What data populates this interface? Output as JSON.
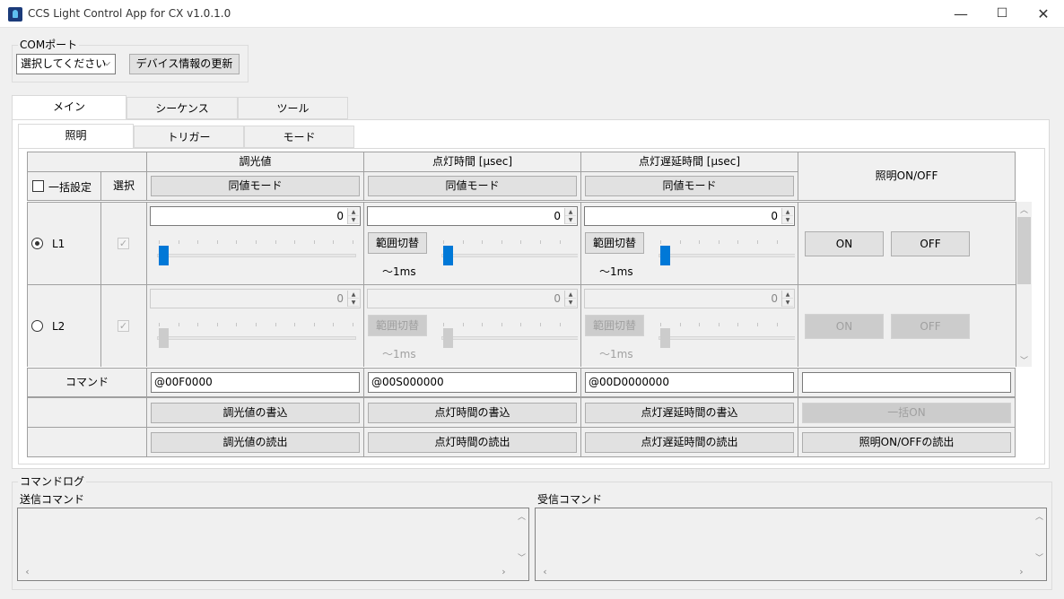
{
  "window": {
    "title": "CCS Light Control App for CX v1.0.1.0",
    "minimize": "—",
    "maximize": "☐",
    "close": "✕"
  },
  "com": {
    "group_label": "COMポート",
    "select_value": "選択してください",
    "refresh_button": "デバイス情報の更新"
  },
  "tabs": [
    "メイン",
    "シーケンス",
    "ツール"
  ],
  "subtabs": [
    "照明",
    "トリガー",
    "モード"
  ],
  "header": {
    "batch_label": "一括設定",
    "select_label": "選択",
    "col_dimming": "調光値",
    "col_on_time": "点灯時間 [μsec]",
    "col_delay": "点灯遅延時間 [μsec]",
    "col_onoff": "照明ON/OFF",
    "same_mode": "同値モード"
  },
  "channels": [
    {
      "name": "L1",
      "selected": true,
      "enabled": true,
      "dimming_value": "0",
      "on_time_value": "0",
      "delay_value": "0",
      "range_button": "範囲切替",
      "range_text": "〜1ms",
      "on_label": "ON",
      "off_label": "OFF",
      "dim_slider": 0,
      "time_slider": 0,
      "delay_slider": 0
    },
    {
      "name": "L2",
      "selected": false,
      "enabled": false,
      "dimming_value": "0",
      "on_time_value": "0",
      "delay_value": "0",
      "range_button": "範囲切替",
      "range_text": "〜1ms",
      "on_label": "ON",
      "off_label": "OFF",
      "dim_slider": 0,
      "time_slider": 0,
      "delay_slider": 0
    }
  ],
  "command_row": {
    "label": "コマンド",
    "dimming_cmd": "@00F0000",
    "on_time_cmd": "@00S000000",
    "delay_cmd": "@00D0000000",
    "onoff_cmd": ""
  },
  "write_row": {
    "dimming": "調光値の書込",
    "on_time": "点灯時間の書込",
    "delay": "点灯遅延時間の書込",
    "batch_on": "一括ON"
  },
  "read_row": {
    "dimming": "調光値の読出",
    "on_time": "点灯時間の読出",
    "delay": "点灯遅延時間の読出",
    "onoff": "照明ON/OFFの読出"
  },
  "log": {
    "group_label": "コマンドログ",
    "sent_label": "送信コマンド",
    "received_label": "受信コマンド",
    "sent_text": "",
    "received_text": ""
  },
  "colors": {
    "accent": "#0078d7",
    "disabled": "#cccccc",
    "window_bg": "#f0f0f0"
  },
  "icons": [
    "app-icon",
    "chevron-down-icon",
    "spin-up-icon",
    "spin-down-icon",
    "scroll-up-icon",
    "scroll-down-icon",
    "scroll-left-icon",
    "scroll-right-icon",
    "checkmark-icon"
  ]
}
